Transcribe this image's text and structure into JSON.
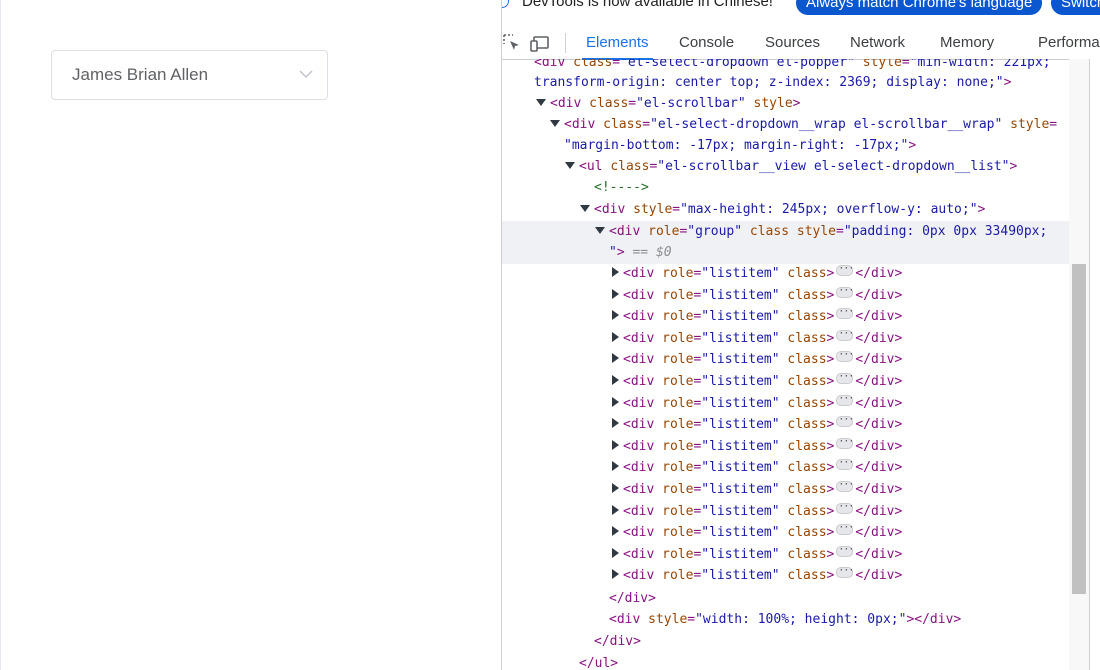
{
  "select": {
    "value": "James Brian Allen"
  },
  "devtools": {
    "info_text": "DevTools is now available in Chinese!",
    "btn_match": "Always match Chrome's language",
    "btn_switch": "Switch",
    "tabs": [
      "Elements",
      "Console",
      "Sources",
      "Network",
      "Memory",
      "Performance"
    ],
    "selected_marker": "== $0",
    "listitem_count": 15,
    "colors": {
      "accent": "#1a73e8",
      "tag": "#881280",
      "attr_name": "#994500",
      "attr_value": "#1a1aa6",
      "comment": "#236e25"
    }
  }
}
